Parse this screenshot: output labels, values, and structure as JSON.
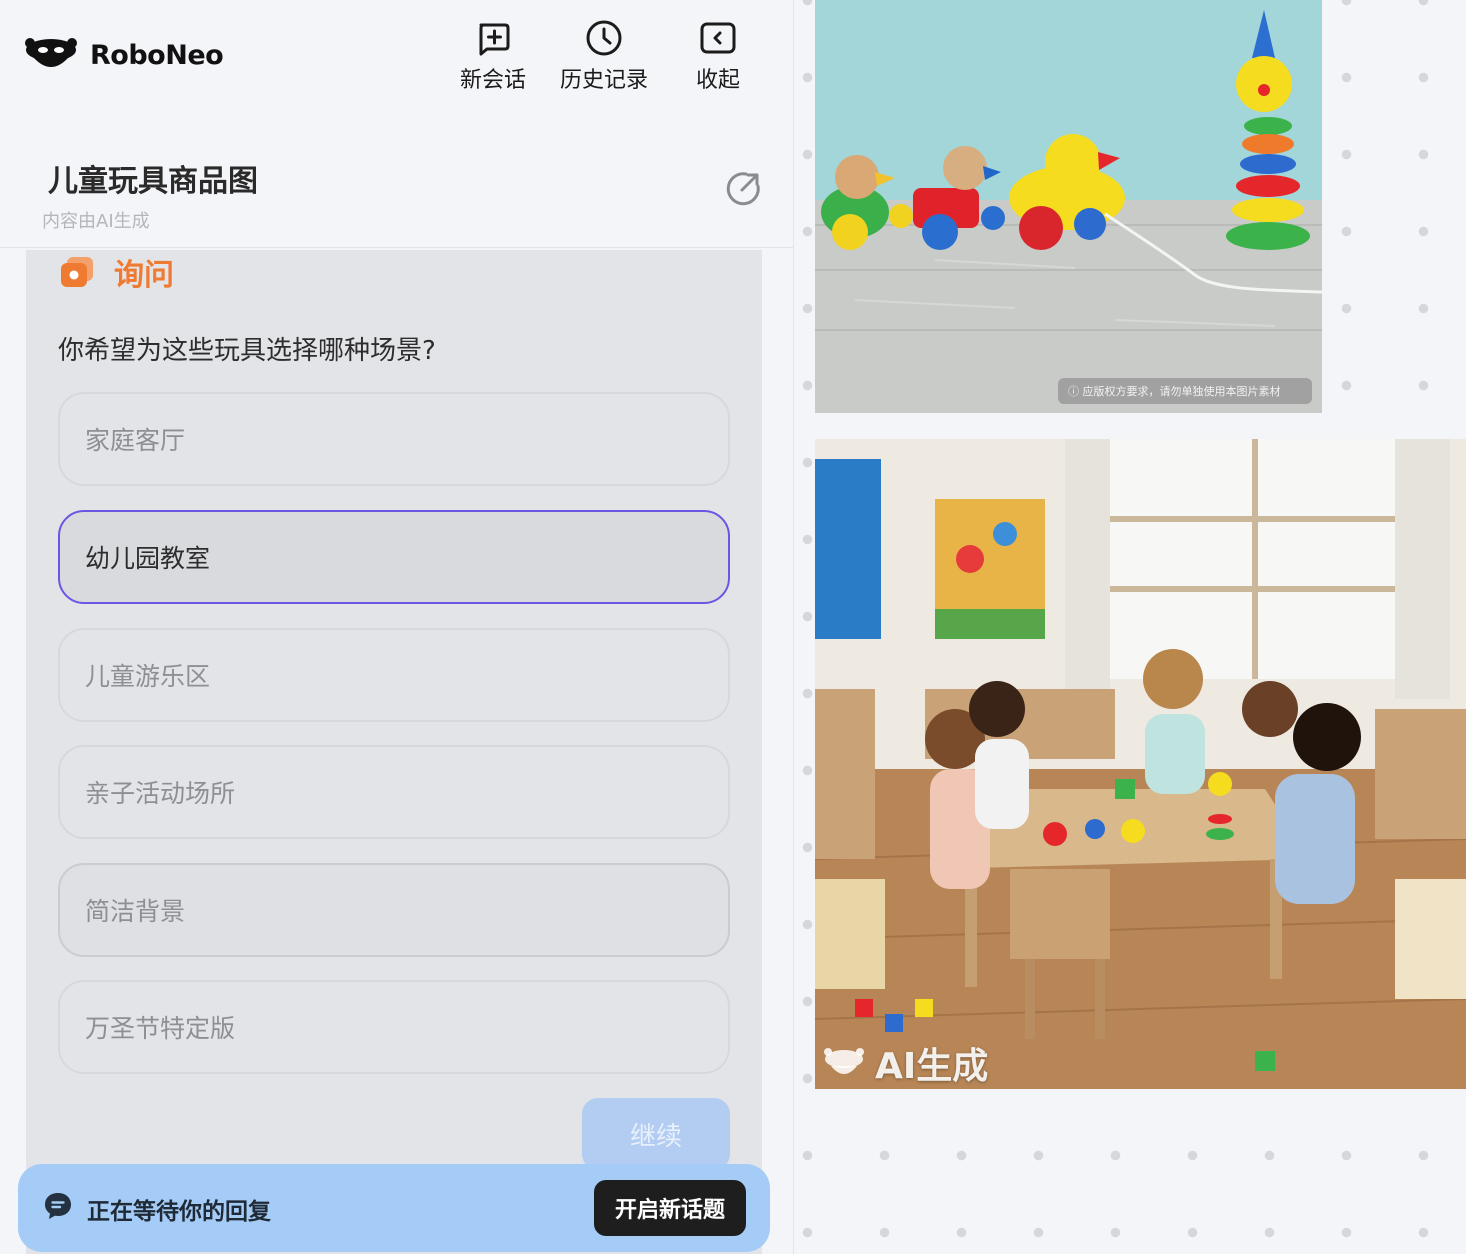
{
  "app": {
    "name": "RoboNeo"
  },
  "top_actions": [
    {
      "label": "新会话",
      "icon": "chat-plus-icon"
    },
    {
      "label": "历史记录",
      "icon": "clock-icon"
    },
    {
      "label": "收起",
      "icon": "collapse-icon"
    }
  ],
  "conversation": {
    "title": "儿童玩具商品图",
    "subtitle": "内容由AI生成",
    "share_icon": "share-icon"
  },
  "ask": {
    "label": "询问",
    "question": "你希望为这些玩具选择哪种场景?",
    "options": [
      {
        "label": "家庭客厅",
        "state": "default"
      },
      {
        "label": "幼儿园教室",
        "state": "selected"
      },
      {
        "label": "儿童游乐区",
        "state": "default"
      },
      {
        "label": "亲子活动场所",
        "state": "default"
      },
      {
        "label": "简洁背景",
        "state": "hovered"
      },
      {
        "label": "万圣节特定版",
        "state": "default"
      }
    ],
    "continue_label": "继续"
  },
  "status_bar": {
    "text": "正在等待你的回复",
    "button_label": "开启新话题"
  },
  "canvas": {
    "image1": {
      "notice": "ⓘ 应版权方要求，请勿单独使用本图片素材"
    },
    "image2": {
      "watermark": "AI生成"
    }
  },
  "colors": {
    "accent_orange": "#ef7a32",
    "selected_border": "#6b55e5",
    "status_bar": "#a4ccf6",
    "continue_disabled": "#b3cdf2"
  }
}
